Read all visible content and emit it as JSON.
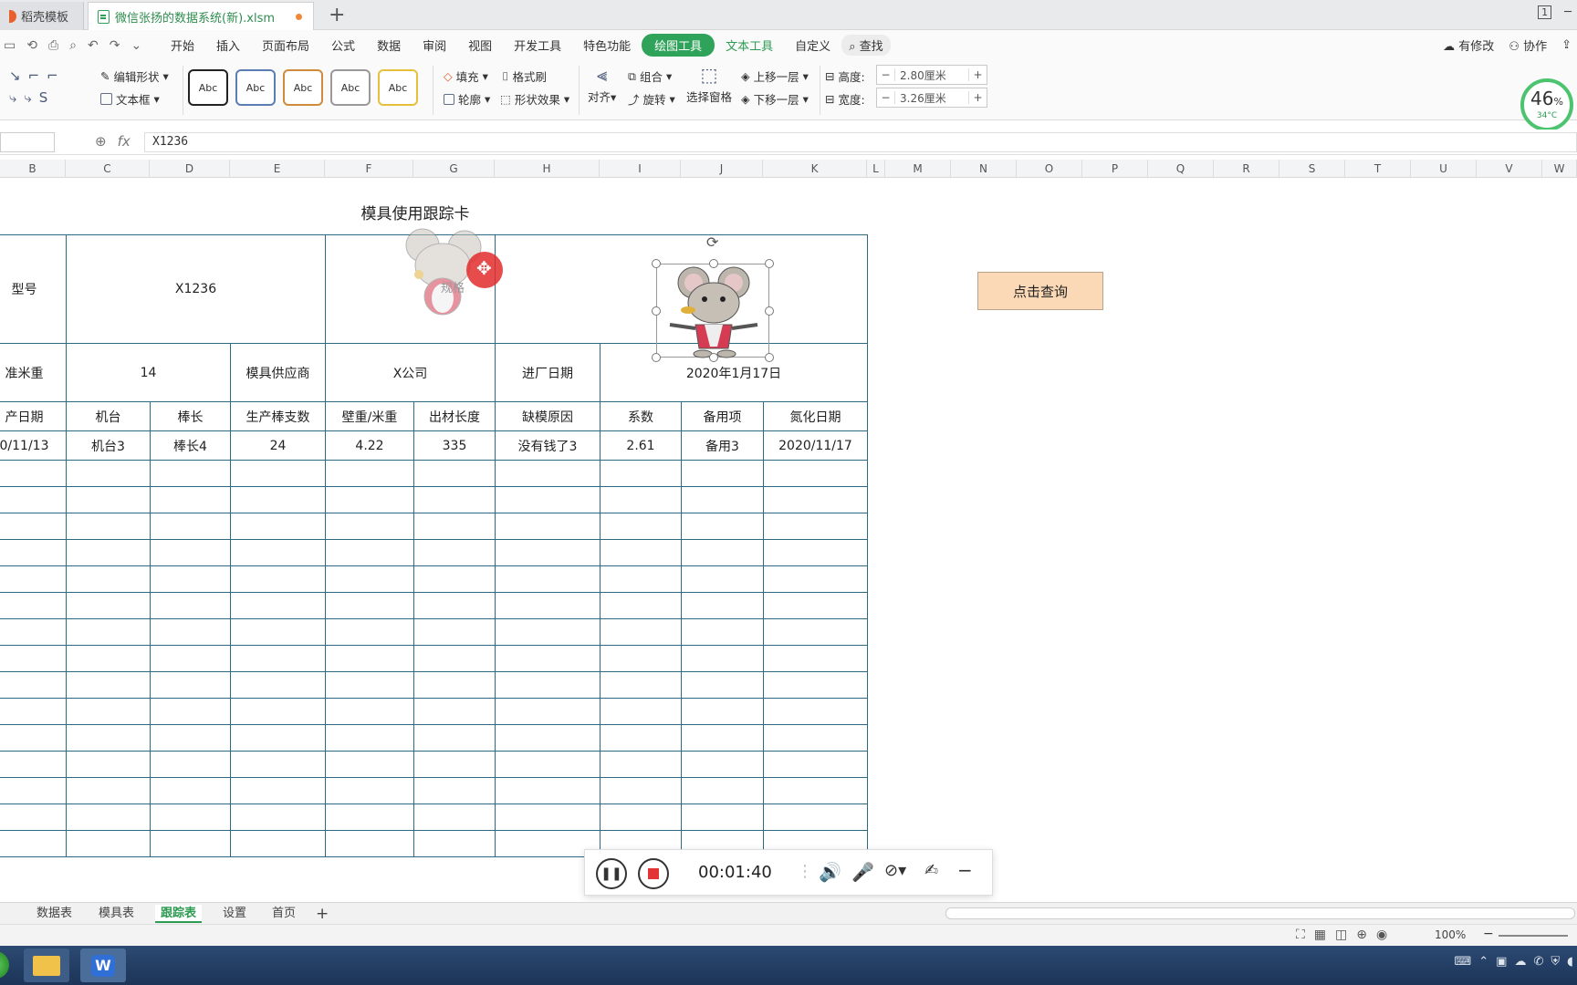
{
  "titlebar": {
    "tab1": "稻壳模板",
    "tab2": "微信张扬的数据系统(新).xlsm",
    "new_tab": "+",
    "window_badge": "1"
  },
  "menubar": {
    "items": [
      "开始",
      "插入",
      "页面布局",
      "公式",
      "数据",
      "审阅",
      "视图",
      "开发工具",
      "特色功能"
    ],
    "active": "绘图工具",
    "text_tools": "文本工具",
    "custom": "自定义",
    "search": "查找",
    "modified": "有修改",
    "collab": "协作"
  },
  "ribbon": {
    "edit_shape": "编辑形状",
    "textbox": "文本框",
    "styles": [
      "Abc",
      "Abc",
      "Abc",
      "Abc",
      "Abc"
    ],
    "style_colors": [
      "#222222",
      "#5b7db1",
      "#d08a3c",
      "#999999",
      "#e6c03a"
    ],
    "fill": "填充",
    "format_brush": "格式刷",
    "outline": "轮廓",
    "shape_effect": "形状效果",
    "align": "对齐",
    "group": "组合",
    "rotate": "旋转",
    "selection_pane": "选择窗格",
    "bring_forward": "上移一层",
    "send_backward": "下移一层",
    "height_label": "高度:",
    "height_value": "2.80厘米",
    "width_label": "宽度:",
    "width_value": "3.26厘米"
  },
  "gauge": {
    "percent": "46",
    "unit": "%",
    "temp": "34°C"
  },
  "formula": {
    "fx": "fx",
    "value": "X1236"
  },
  "columns": [
    "B",
    "C",
    "D",
    "E",
    "F",
    "G",
    "H",
    "I",
    "J",
    "K",
    "L",
    "M",
    "N",
    "O",
    "P",
    "Q",
    "R",
    "S",
    "T",
    "U",
    "V",
    "W"
  ],
  "sheet": {
    "title": "模具使用跟踪卡",
    "row1": {
      "label": "型号",
      "value": "X1236",
      "pic_label": "规格"
    },
    "row2": {
      "label": "准米重",
      "value": "14",
      "supplier_label": "模具供应商",
      "supplier": "X公司",
      "date_label": "进厂日期",
      "date": "2020年1月17日"
    },
    "headers": [
      "产日期",
      "机台",
      "棒长",
      "生产棒支数",
      "壁重/米重",
      "出材长度",
      "缺模原因",
      "系数",
      "备用项",
      "氮化日期"
    ],
    "data_row": [
      "0/11/13",
      "机台3",
      "棒长4",
      "24",
      "4.22",
      "335",
      "没有钱了3",
      "2.61",
      "备用3",
      "2020/11/17"
    ],
    "query_button": "点击查询"
  },
  "recorder": {
    "time": "00:01:40"
  },
  "sheet_tabs": [
    "数据表",
    "模具表",
    "跟踪表",
    "设置",
    "首页"
  ],
  "active_sheet": "跟踪表",
  "status": {
    "zoom": "100%"
  }
}
